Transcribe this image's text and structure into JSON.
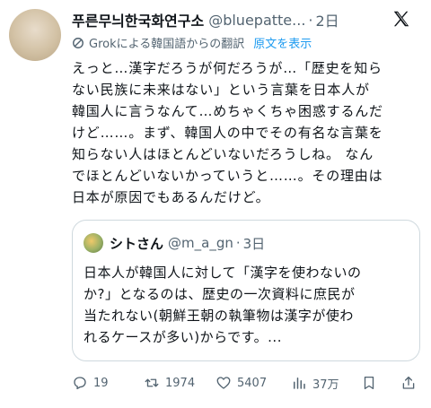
{
  "post": {
    "author_name": "푸른무늬한국화연구소",
    "author_handle": "@bluepatte...",
    "separator": "·",
    "time": "2日",
    "translation_note": "Grokによる韓国語からの翻訳",
    "show_original": "原文を表示",
    "text_lines": [
      "えっと…漢字だろうが何だろうが…「歴史を知ら",
      "ない民族に未来はない」という言葉を日本人が",
      "韓国人に言うなんて…めちゃくちゃ困惑するんだ",
      "けど……。まず、韓国人の中でその有名な言葉を",
      "知らない人はほとんどいないだろうしね。 なん",
      "でほとんどいないかっていうと……。その理由は",
      "日本が原因でもあるんだけど。"
    ]
  },
  "quote": {
    "author_name": "シトさん",
    "author_handle": "@m_a_gn",
    "separator": "·",
    "time": "3日",
    "text_lines": [
      "日本人が韓国人に対して「漢字を使わないの",
      "か?」となるのは、歴史の一次資料に庶民が",
      "当たれない(朝鮮王朝の執筆物は漢字が使わ",
      "れるケースが多い)からです。..."
    ]
  },
  "actions": {
    "replies": "19",
    "reposts": "1974",
    "likes": "5407",
    "views": "37万"
  },
  "icons": {
    "logo": "x-logo-icon",
    "translate": "grok-icon",
    "reply": "reply-icon",
    "repost": "repost-icon",
    "like": "heart-icon",
    "views": "views-icon",
    "bookmark": "bookmark-icon",
    "share": "share-icon"
  },
  "colors": {
    "text": "#0f1419",
    "secondary": "#536471",
    "link": "#1d9bf0",
    "border": "#cfd9de"
  }
}
